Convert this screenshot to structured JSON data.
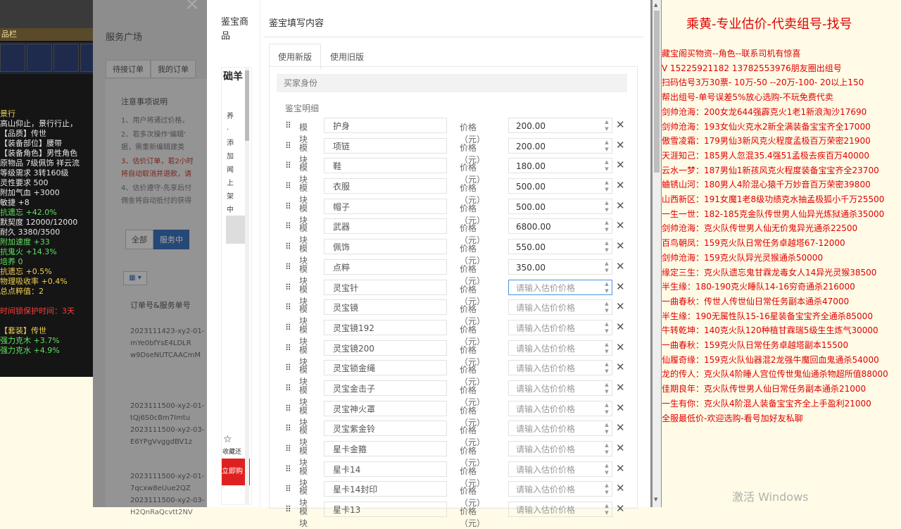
{
  "game_panel": {
    "header": "品栏",
    "lines": [
      {
        "text": "景行",
        "c": "c-y"
      },
      {
        "text": "高山仰止，景行行止，",
        "c": "c-w"
      },
      {
        "text": "【品质】传世",
        "c": "c-w"
      },
      {
        "text": "【装备部位】腰带",
        "c": "c-w"
      },
      {
        "text": "【装备角色】男性角色",
        "c": "c-w"
      },
      {
        "text": "原物品 7级佩饰 祥云流",
        "c": "c-w"
      },
      {
        "text": "等级需求 3转160级",
        "c": "c-w"
      },
      {
        "text": "灵性要求 500",
        "c": "c-w"
      },
      {
        "text": "附加气血 +3000",
        "c": "c-w"
      },
      {
        "text": "敏捷 +8",
        "c": "c-w"
      },
      {
        "text": "抗遗忘 +42.0%",
        "c": "c-g"
      },
      {
        "text": "默契度 12000/12000",
        "c": "c-w"
      },
      {
        "text": "耐久 3380/3500",
        "c": "c-w"
      },
      {
        "text": "附加速度 +33",
        "c": "c-g"
      },
      {
        "text": "抗鬼火 +14.3%",
        "c": "c-g"
      },
      {
        "text": "培养 0",
        "c": "c-g"
      },
      {
        "text": "抗遗忘 +0.5%",
        "c": "c-y"
      },
      {
        "text": "物理吸收率 +0.4%",
        "c": "c-y"
      },
      {
        "text": "总点粹值：2",
        "c": "c-y"
      },
      {
        "text": "",
        "c": "c-w"
      },
      {
        "text": "时间锁保护时间：3天",
        "c": "c-r"
      },
      {
        "text": "",
        "c": "c-w"
      },
      {
        "text": "【套装】传世",
        "c": "c-y"
      },
      {
        "text": "强力克木 +3.7%",
        "c": "c-g"
      },
      {
        "text": "强力克水 +4.9%",
        "c": "c-g"
      }
    ]
  },
  "bg_page": {
    "title": "服务广场",
    "tabs": [
      "待接订单",
      "我的订单"
    ],
    "notice_title": "注意事项说明",
    "notice_lines": [
      "1、用户将通过价格，",
      "2、若多次操作'编辑'",
      "据，需重新编辑建类",
      "3、估价订单，若2小时",
      "将自动取消并退款，请",
      "4、估价遵守-先享后付",
      "佣金将自动抵付的获得"
    ],
    "filters": [
      "全部",
      "服务中"
    ],
    "order_header": "订单号&服务单号",
    "orders": [
      [
        "2023111423-xy2-01-",
        "mYe0bfYsE4LDLR",
        "w9DseNUTCAACmM"
      ],
      [
        "2023111500-xy2-01-",
        "tQj6S0cBm7Imtu",
        "2023111500-xy2-03-",
        "E6YPgVvggdBV1z"
      ],
      [
        "2023111500-xy2-01-",
        "7qcxw8eUue2QZ",
        "2023111500-xy2-03-",
        "H2QnRaQcvtt2NV"
      ]
    ]
  },
  "modal": {
    "left_title": "鉴宝商品",
    "side": {
      "logo": "础羊",
      "vertical": "养·添加闻上架中",
      "fav": "收藏还",
      "red_btn": "立即购"
    },
    "title": "鉴宝填写内容",
    "tabs": [
      "使用新版",
      "使用旧版"
    ],
    "buyer_label": "买家身份",
    "detail_label": "鉴宝明细",
    "module_label": "模块",
    "price_label": "价格（元）",
    "price_placeholder": "请输入估价价格",
    "rows": [
      {
        "name": "护身",
        "price": "200.00"
      },
      {
        "name": "项链",
        "price": "200.00"
      },
      {
        "name": "鞋",
        "price": "180.00"
      },
      {
        "name": "衣服",
        "price": "500.00"
      },
      {
        "name": "帽子",
        "price": "500.00"
      },
      {
        "name": "武器",
        "price": "6800.00"
      },
      {
        "name": "佩饰",
        "price": "550.00"
      },
      {
        "name": "点粹",
        "price": "350.00"
      },
      {
        "name": "灵宝针",
        "price": ""
      },
      {
        "name": "灵宝镜",
        "price": ""
      },
      {
        "name": "灵宝镜192",
        "price": ""
      },
      {
        "name": "灵宝镜200",
        "price": ""
      },
      {
        "name": "灵宝锁金绳",
        "price": ""
      },
      {
        "name": "灵宝金击子",
        "price": ""
      },
      {
        "name": "灵宝神火罩",
        "price": ""
      },
      {
        "name": "灵宝紫金铃",
        "price": ""
      },
      {
        "name": "星卡金箍",
        "price": ""
      },
      {
        "name": "星卡14",
        "price": ""
      },
      {
        "name": "星卡14封印",
        "price": ""
      },
      {
        "name": "星卡13",
        "price": ""
      }
    ]
  },
  "right": {
    "title": "乘黄-专业估价-代卖组号-找号",
    "lines": [
      "藏宝阁买物资--角色--联系司机有惊喜",
      "V 15225921182  13782553976朋友圈出组号",
      "扫码估号3万30票- 10万-50 --20万-100- 20以上150",
      "帮出组号-单号误差5%放心选购-不玩免费代卖",
      "剑帅沧海：200女龙644强霹克火1老1新浪淘沙17690",
      "剑帅沧海：193女仙火克水2新全满装备宝宝齐全17000",
      "傲雪凌霜：179男仙3新风克火程度孟极百万荣密21900",
      "天涯知己：185男人忽混35.4强51孟极去疾百万40000",
      "云水一梦：187男仙1新孩风克火程度装备宝宝齐全23700",
      "蛐锈山河：180男人4阶混心猿千万妙音百万荣密39800",
      "山西新区：191女魔1老8级功绩克水抽孟极狐小千万25500",
      "一生一世：182-185克金队传世男人仙异光炼狱通杀35000",
      "剑帅沧海：克火队传世男人仙无价鬼异光通杀22500",
      "百鸟朝凤：159克火队日常任务卓越塔67-12000",
      "剑帅沧海：159克火队异光灵猴通杀50000",
      "缘定三生：克火队遗忘鬼甘霖龙毒女人14异光灵猴38500",
      "半生缘：180-190克火睡队14-16穷奇通杀216000",
      "一曲春秋：传世人传世仙日常任务副本通杀47000",
      "半生缘：190无属性队15-16星装备宝宝齐全通杀85000",
      "牛转乾坤：140克火队120种植甘霖瑞5级生生炼气30000",
      "一曲春秋：159克火队日常任务卓越塔副本15500",
      "仙履奇缘：159克火队仙器混2龙强牛魔回血鬼通杀54000",
      "龙的传人：克火队4阶睡人宫位传世鬼仙通杀物超所值88000",
      "佳期良年：克火队传世男人仙日常任务副本通杀21000",
      "一生有你：克火队4阶混人装备宝宝齐全上手盈利21000",
      "全服最低价-欢迎选购-看号加好友私聊"
    ],
    "watermark": "激活 Windows"
  }
}
